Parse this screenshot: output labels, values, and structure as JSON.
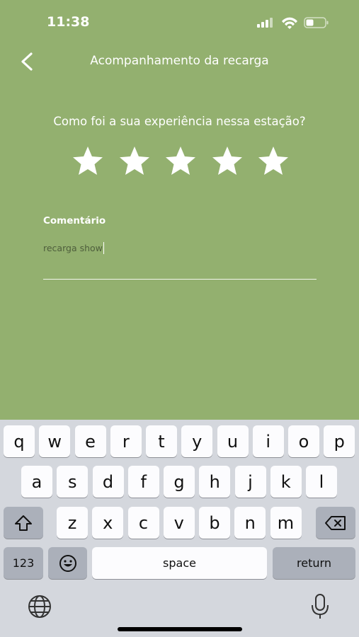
{
  "status_bar": {
    "time": "11:38"
  },
  "header": {
    "title": "Acompanhamento da recarga"
  },
  "rating": {
    "question": "Como foi a sua experiência nessa estação?",
    "selected": 5,
    "max": 5
  },
  "comment": {
    "label": "Comentário",
    "value": "recarga show"
  },
  "keyboard": {
    "row1": [
      "q",
      "w",
      "e",
      "r",
      "t",
      "y",
      "u",
      "i",
      "o",
      "p"
    ],
    "row2": [
      "a",
      "s",
      "d",
      "f",
      "g",
      "h",
      "j",
      "k",
      "l"
    ],
    "row3": [
      "z",
      "x",
      "c",
      "v",
      "b",
      "n",
      "m"
    ],
    "numbers_label": "123",
    "space_label": "space",
    "return_label": "return"
  },
  "colors": {
    "background": "#93b06f",
    "keyboard_bg": "#d4d7dd",
    "key": "#fcfcfe",
    "key_dark": "#abb0ba"
  }
}
